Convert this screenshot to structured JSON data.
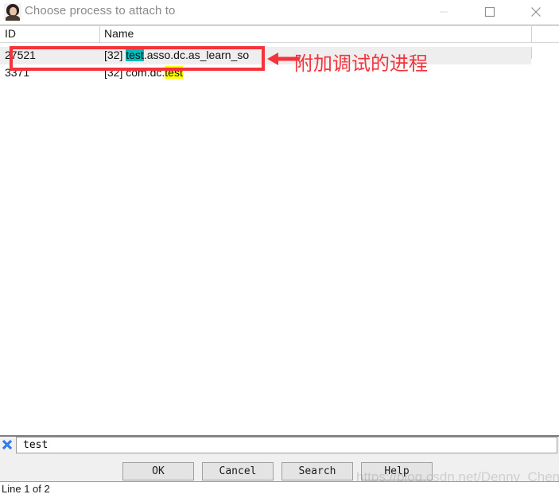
{
  "window": {
    "title": "Choose process to attach to",
    "icon": "person-avatar-icon",
    "controls": {
      "minimize_label": "Minimize",
      "maximize_label": "Maximize",
      "close_label": "Close"
    }
  },
  "table": {
    "columns": [
      {
        "key": "id",
        "label": "ID"
      },
      {
        "key": "name",
        "label": "Name"
      }
    ],
    "rows": [
      {
        "id": "27521",
        "name_prefix": "[32] ",
        "name_highlight": "test",
        "name_highlight_color": "#00bcbc",
        "name_suffix": ".asso.dc.as_learn_so",
        "selected": true
      },
      {
        "id": "3371",
        "name_prefix": "[32] com.dc.",
        "name_highlight": "test",
        "name_highlight_color": "#ffff00",
        "name_suffix": "",
        "selected": false
      }
    ]
  },
  "annotation": {
    "text": "附加调试的进程",
    "color": "#f4333d"
  },
  "search": {
    "value": "test",
    "placeholder": "",
    "clear_icon": "blue-x-clear-icon"
  },
  "buttons": {
    "ok": "OK",
    "cancel": "Cancel",
    "search": "Search",
    "help": "Help"
  },
  "status": {
    "text": "Line 1 of 2"
  },
  "watermark": {
    "text": "https://blog.csdn.net/Denny_Chen_"
  }
}
